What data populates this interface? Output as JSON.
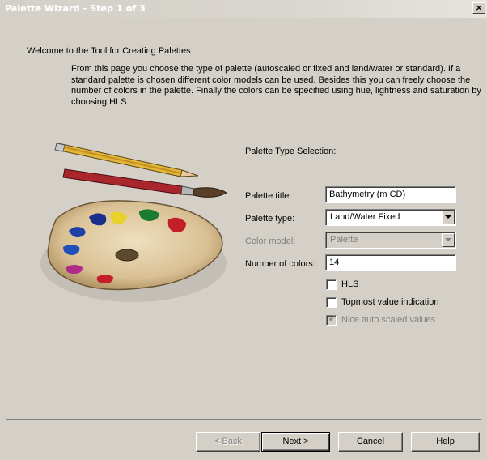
{
  "window": {
    "title": "Palette Wizard - Step 1 of 3",
    "close_label": "×"
  },
  "intro": {
    "welcome": "Welcome to the Tool for Creating Palettes",
    "description": "From this page you choose the type of palette (autoscaled or fixed and land/water or standard). If a standard palette is chosen different color models can be used. Besides this you can freely choose the number of colors in the palette. Finally the colors can be specified using hue, lightness and saturation by choosing HLS."
  },
  "illustration": {
    "icon": "painter-palette-icon"
  },
  "form": {
    "section_title": "Palette Type Selection:",
    "palette_title": {
      "label": "Palette title:",
      "value": "Bathymetry (m CD)"
    },
    "palette_type": {
      "label": "Palette type:",
      "value": "Land/Water Fixed"
    },
    "color_model": {
      "label": "Color model:",
      "value": "Palette",
      "enabled": false
    },
    "number_of_colors": {
      "label": "Number of colors:",
      "value": "14"
    },
    "hls": {
      "label": "HLS",
      "checked": false
    },
    "topmost_value": {
      "label": "Topmost value indication",
      "checked": false
    },
    "nice_auto_scaled": {
      "label": "Nice auto scaled values",
      "checked": true,
      "enabled": false
    }
  },
  "buttons": {
    "back": "< Back",
    "next": "Next >",
    "cancel": "Cancel",
    "help": "Help"
  },
  "colors": {
    "dialog_background": "#d4d0c8",
    "disabled_text": "#808080"
  }
}
